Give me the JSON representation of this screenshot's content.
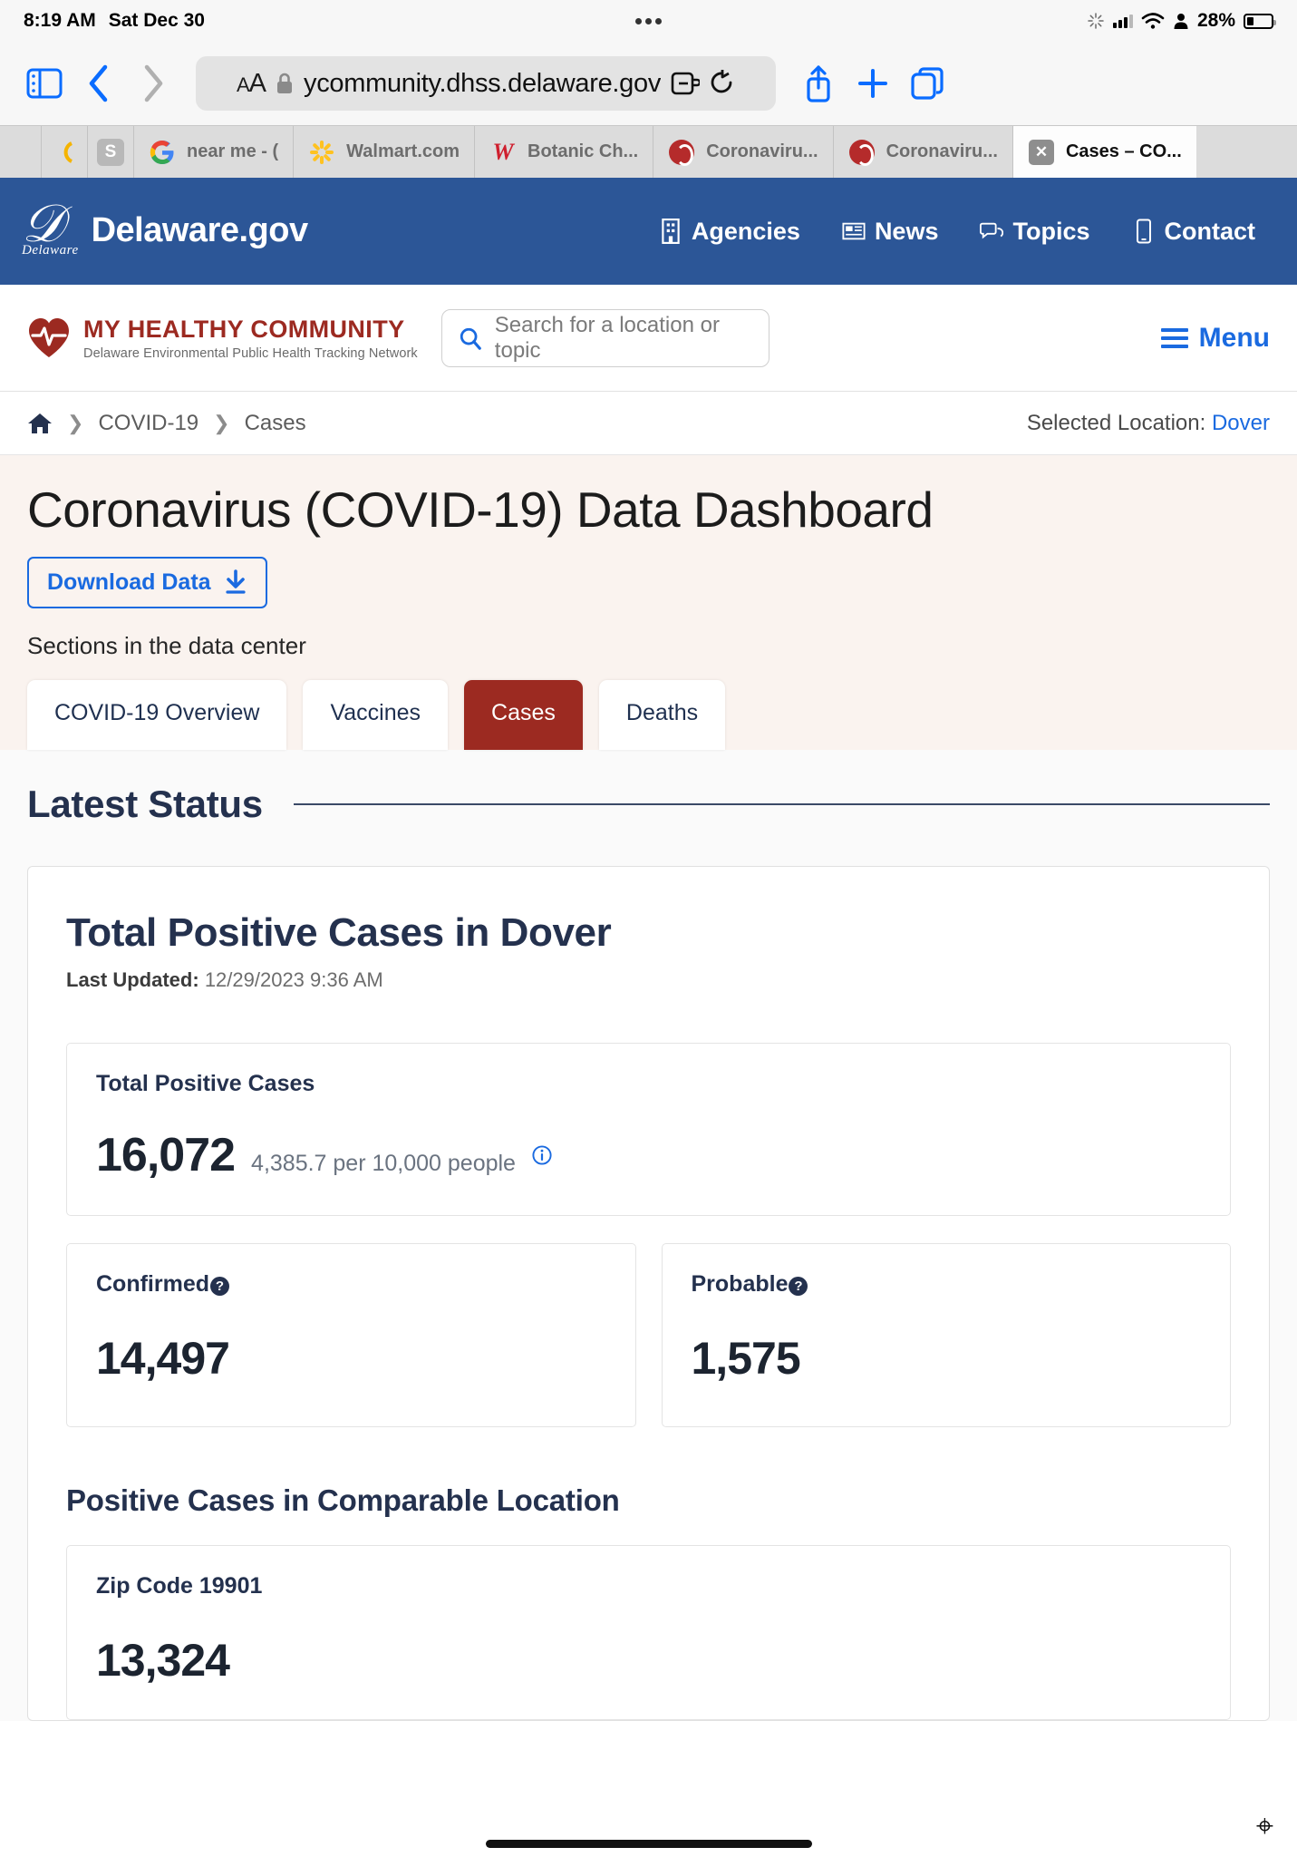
{
  "status_bar": {
    "time": "8:19 AM",
    "date": "Sat Dec 30",
    "battery_percent": "28%"
  },
  "browser": {
    "url": "ycommunity.dhss.delaware.gov",
    "aa_label": "AA",
    "tabs": [
      {
        "title": "",
        "favicon": "generic-icon",
        "active": false
      },
      {
        "title": "",
        "favicon": "s-icon",
        "active": false
      },
      {
        "title": "near me - (",
        "favicon": "google-icon",
        "active": false
      },
      {
        "title": "Walmart.com",
        "favicon": "walmart-icon",
        "active": false
      },
      {
        "title": "Botanic Ch...",
        "favicon": "walgreens-icon",
        "active": false
      },
      {
        "title": "Coronaviru...",
        "favicon": "coronavirus-icon",
        "active": false
      },
      {
        "title": "Coronaviru...",
        "favicon": "coronavirus-icon",
        "active": false
      },
      {
        "title": "Cases – CO...",
        "favicon": "x-icon",
        "active": true
      }
    ]
  },
  "delaware_bar": {
    "brand": "Delaware.gov",
    "brand_sub": "Delaware",
    "nav": [
      {
        "label": "Agencies",
        "icon": "building-icon"
      },
      {
        "label": "News",
        "icon": "newspaper-icon"
      },
      {
        "label": "Topics",
        "icon": "chat-icon"
      },
      {
        "label": "Contact",
        "icon": "phone-icon"
      }
    ]
  },
  "site_header": {
    "logo_title": "MY HEALTHY COMMUNITY",
    "logo_subtitle": "Delaware Environmental Public Health Tracking Network",
    "search_placeholder": "Search for a location or topic",
    "menu_label": "Menu"
  },
  "breadcrumb": {
    "items": [
      "COVID-19",
      "Cases"
    ],
    "selected_location_label": "Selected Location:",
    "selected_location": "Dover"
  },
  "page": {
    "title": "Coronavirus (COVID-19) Data Dashboard",
    "download_label": "Download Data",
    "sections_label": "Sections in the data center",
    "tabs": [
      {
        "label": "COVID-19 Overview",
        "active": false
      },
      {
        "label": "Vaccines",
        "active": false
      },
      {
        "label": "Cases",
        "active": true
      },
      {
        "label": "Deaths",
        "active": false
      }
    ]
  },
  "main": {
    "section_title": "Latest Status",
    "card_title": "Total Positive Cases in Dover",
    "last_updated_label": "Last Updated:",
    "last_updated_value": "12/29/2023 9:36 AM",
    "total": {
      "label": "Total Positive Cases",
      "value": "16,072",
      "rate": "4,385.7 per 10,000 people"
    },
    "confirmed": {
      "label": "Confirmed",
      "value": "14,497"
    },
    "probable": {
      "label": "Probable",
      "value": "1,575"
    },
    "comparable_title": "Positive Cases in Comparable Location",
    "comparable": {
      "label": "Zip Code 19901",
      "value": "13,324"
    }
  },
  "colors": {
    "delaware_blue": "#2c5697",
    "brand_red": "#9c2a21",
    "link_blue": "#1a6ae0",
    "navy": "#24314e",
    "cream": "#faf3ef"
  }
}
